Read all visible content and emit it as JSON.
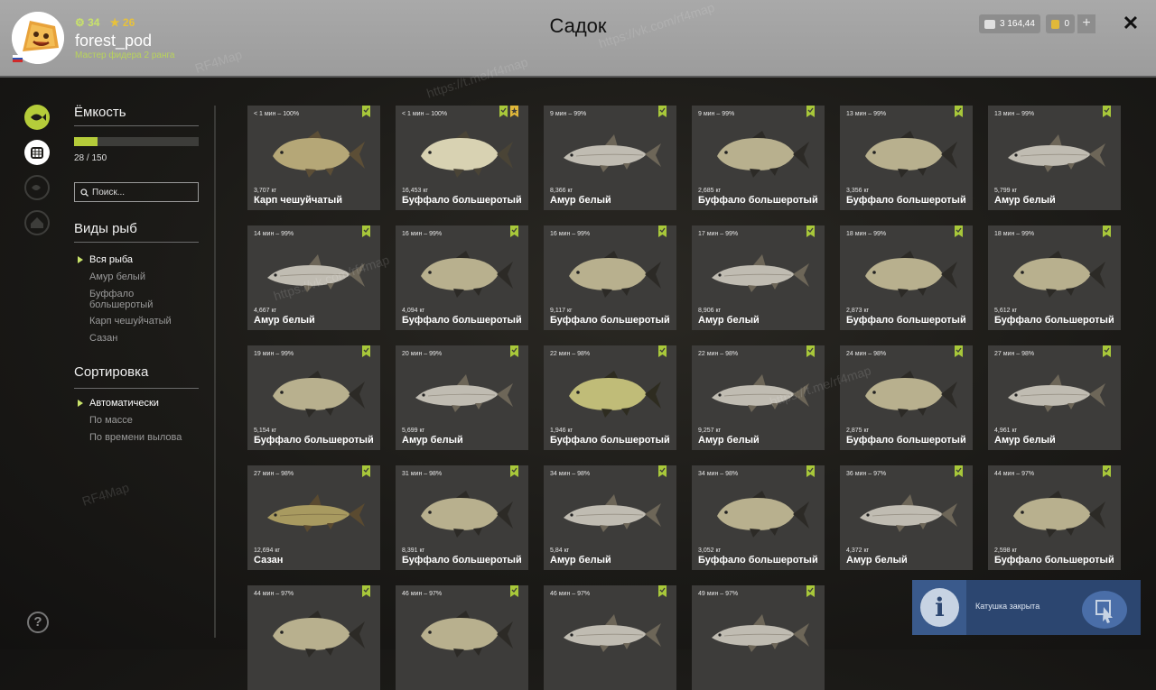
{
  "header": {
    "title": "Садок",
    "username": "forest_pod",
    "rank": "Мастер фидера 2 ранга",
    "level_a": "34",
    "level_b": "26",
    "silver": "3 164,44",
    "gold": "0",
    "plus": "+",
    "close": "✕"
  },
  "sidebar": {
    "capacity_title": "Ёмкость",
    "capacity_count": "28 / 150",
    "capacity_fraction": 0.187,
    "search_placeholder": "Поиск...",
    "species_title": "Виды рыб",
    "species": [
      "Вся рыба",
      "Амур белый",
      "Буффало большеротый",
      "Карп чешуйчатый",
      "Сазан"
    ],
    "sort_title": "Сортировка",
    "sort": [
      "Автоматически",
      "По массе",
      "По времени вылова"
    ],
    "help": "?"
  },
  "fish": [
    {
      "time": "< 1 мин – 100%",
      "weight": "3,707 кг",
      "name": "Карп чешуйчатый",
      "kind": "carp",
      "extra_badge": false
    },
    {
      "time": "< 1 мин – 100%",
      "weight": "16,453 кг",
      "name": "Буффало большеротый",
      "kind": "buffalo_light",
      "extra_badge": true
    },
    {
      "time": "9 мин – 99%",
      "weight": "8,366 кг",
      "name": "Амур белый",
      "kind": "amur",
      "extra_badge": false
    },
    {
      "time": "9 мин – 99%",
      "weight": "2,685 кг",
      "name": "Буффало большеротый",
      "kind": "buffalo",
      "extra_badge": false
    },
    {
      "time": "13 мин – 99%",
      "weight": "3,356 кг",
      "name": "Буффало большеротый",
      "kind": "buffalo",
      "extra_badge": false
    },
    {
      "time": "13 мин – 99%",
      "weight": "5,799 кг",
      "name": "Амур белый",
      "kind": "amur",
      "extra_badge": false
    },
    {
      "time": "14 мин – 99%",
      "weight": "4,667 кг",
      "name": "Амур белый",
      "kind": "amur",
      "extra_badge": false
    },
    {
      "time": "16 мин – 99%",
      "weight": "4,094 кг",
      "name": "Буффало большеротый",
      "kind": "buffalo",
      "extra_badge": false
    },
    {
      "time": "16 мин – 99%",
      "weight": "9,117 кг",
      "name": "Буффало большеротый",
      "kind": "buffalo",
      "extra_badge": false
    },
    {
      "time": "17 мин – 99%",
      "weight": "8,906 кг",
      "name": "Амур белый",
      "kind": "amur",
      "extra_badge": false
    },
    {
      "time": "18 мин – 99%",
      "weight": "2,873 кг",
      "name": "Буффало большеротый",
      "kind": "buffalo",
      "extra_badge": false
    },
    {
      "time": "18 мин – 99%",
      "weight": "5,612 кг",
      "name": "Буффало большеротый",
      "kind": "buffalo",
      "extra_badge": false
    },
    {
      "time": "19 мин – 99%",
      "weight": "5,154 кг",
      "name": "Буффало большеротый",
      "kind": "buffalo",
      "extra_badge": false
    },
    {
      "time": "20 мин – 99%",
      "weight": "5,699 кг",
      "name": "Амур белый",
      "kind": "amur",
      "extra_badge": false
    },
    {
      "time": "22 мин – 98%",
      "weight": "1,946 кг",
      "name": "Буффало большеротый",
      "kind": "buffalo_green",
      "extra_badge": false
    },
    {
      "time": "22 мин – 98%",
      "weight": "9,257 кг",
      "name": "Амур белый",
      "kind": "amur",
      "extra_badge": false
    },
    {
      "time": "24 мин – 98%",
      "weight": "2,875 кг",
      "name": "Буффало большеротый",
      "kind": "buffalo",
      "extra_badge": false
    },
    {
      "time": "27 мин – 98%",
      "weight": "4,961 кг",
      "name": "Амур белый",
      "kind": "amur",
      "extra_badge": false
    },
    {
      "time": "27 мин – 98%",
      "weight": "12,694 кг",
      "name": "Сазан",
      "kind": "sazan",
      "extra_badge": false
    },
    {
      "time": "31 мин – 98%",
      "weight": "8,391 кг",
      "name": "Буффало большеротый",
      "kind": "buffalo",
      "extra_badge": false
    },
    {
      "time": "34 мин – 98%",
      "weight": "5,84 кг",
      "name": "Амур белый",
      "kind": "amur",
      "extra_badge": false
    },
    {
      "time": "34 мин – 98%",
      "weight": "3,052 кг",
      "name": "Буффало большеротый",
      "kind": "buffalo",
      "extra_badge": false
    },
    {
      "time": "36 мин – 97%",
      "weight": "4,372 кг",
      "name": "Амур белый",
      "kind": "amur",
      "extra_badge": false
    },
    {
      "time": "44 мин – 97%",
      "weight": "2,598 кг",
      "name": "Буффало большеротый",
      "kind": "buffalo",
      "extra_badge": false
    },
    {
      "time": "44 мин – 97%",
      "weight": "",
      "name": "",
      "kind": "buffalo",
      "extra_badge": false
    },
    {
      "time": "46 мин – 97%",
      "weight": "",
      "name": "",
      "kind": "buffalo",
      "extra_badge": false
    },
    {
      "time": "46 мин – 97%",
      "weight": "",
      "name": "",
      "kind": "amur",
      "extra_badge": false
    },
    {
      "time": "49 мин – 97%",
      "weight": "",
      "name": "",
      "kind": "amur",
      "extra_badge": false
    }
  ],
  "notification": {
    "icon": "i",
    "text": "Катушка закрыта"
  },
  "watermarks": [
    "RF4Map",
    "https://vk.com/rf4map",
    "https://t.me/rf4map"
  ],
  "colors": {
    "accent": "#b5cc3a",
    "badge_green": "#a8c83a",
    "badge_gold": "#e0b83a",
    "notification_bg": "#2c4670"
  }
}
